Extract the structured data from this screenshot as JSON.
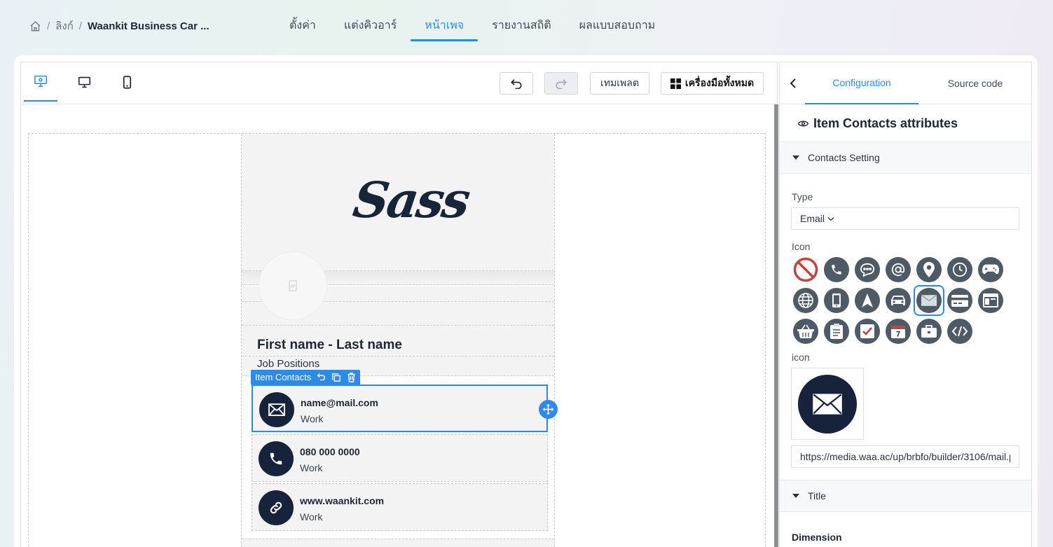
{
  "breadcrumb": {
    "link": "ลิงก์",
    "current": "Waankit Business Car ...",
    "separator": "/"
  },
  "nav_tabs": [
    {
      "label": "ตั้งค่า",
      "active": false
    },
    {
      "label": "แต่งคิวอาร์",
      "active": false
    },
    {
      "label": "หน้าเพจ",
      "active": true
    },
    {
      "label": "รายงานสถิติ",
      "active": false
    },
    {
      "label": "ผลแบบสอบถาม",
      "active": false
    }
  ],
  "toolbar": {
    "template_label": "เทมเพลต",
    "all_tools_label": "เครื่องมือทั้งหมด"
  },
  "card": {
    "logo_text": "Sass",
    "name": "First name - Last name",
    "job": "Job Positions",
    "item_tag_label": "Item Contacts",
    "contacts": [
      {
        "icon": "mail-icon",
        "value": "name@mail.com",
        "label": "Work",
        "selected": true
      },
      {
        "icon": "phone-icon",
        "value": "080 000 0000",
        "label": "Work",
        "selected": false
      },
      {
        "icon": "link-icon",
        "value": "www.waankit.com",
        "label": "Work",
        "selected": false
      }
    ]
  },
  "panel": {
    "tab_config": "Configuration",
    "tab_source": "Source code",
    "attr_title": "Item Contacts attributes",
    "contacts_setting": "Contacts Setting",
    "type_label": "Type",
    "type_value": "Email",
    "icon_label": "Icon",
    "icon_label_lower": "icon",
    "icon_url": "https://media.waa.ac/up/brbfo/builder/3106/mail.png",
    "title_section": "Title",
    "dimension_label": "Dimension",
    "icon_options": [
      "ban-icon",
      "phone-icon",
      "chat-icon",
      "at-icon",
      "location-pin-icon",
      "clock-icon",
      "gamepad-icon",
      "globe-icon",
      "mobile-icon",
      "navigation-arrow-icon",
      "car-icon",
      "mail-icon",
      "credit-card-icon",
      "browser-window-icon",
      "basket-icon",
      "clipboard-icon",
      "checkbox-icon",
      "calendar-icon",
      "briefcase-icon",
      "code-icon"
    ],
    "selected_icon": "mail-icon"
  },
  "colors": {
    "accent": "#2d8ae8",
    "icon_dark": "#16233a",
    "icon_grey": "#4e5a66",
    "ban_red": "#c0453f"
  }
}
